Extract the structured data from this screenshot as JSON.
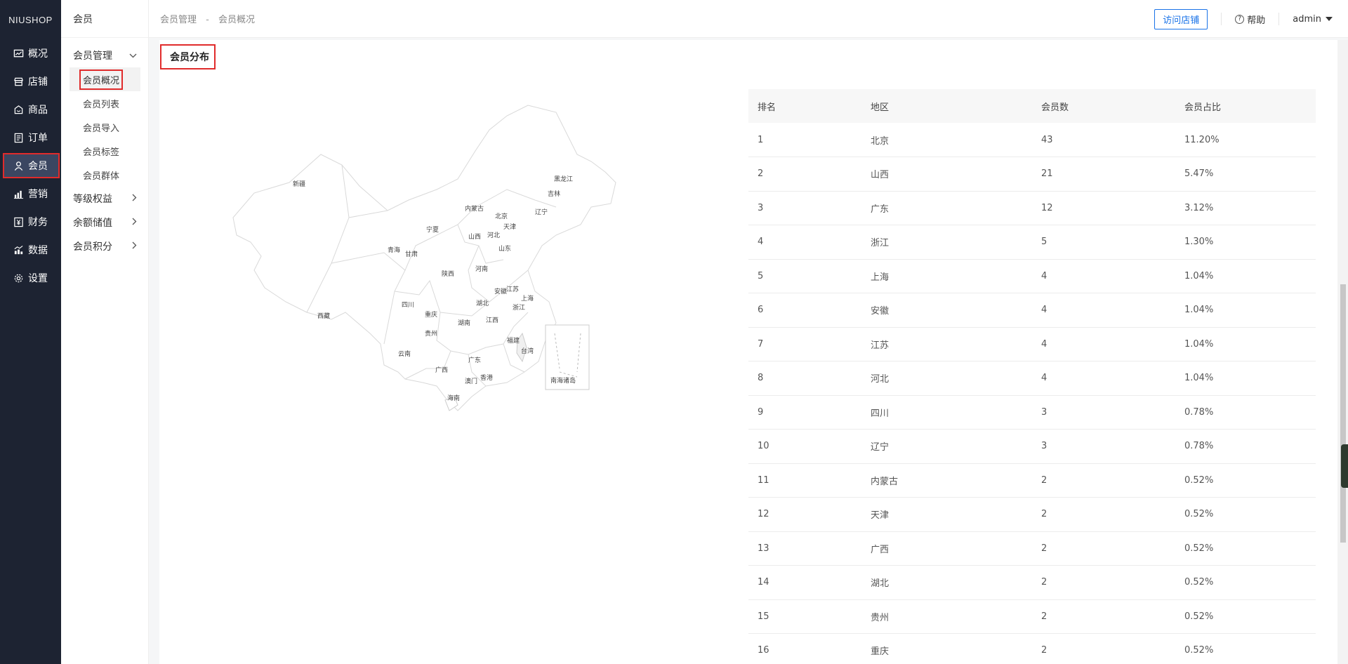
{
  "brand": {
    "logo": "NIUSHOP"
  },
  "nav": [
    {
      "label": "概况",
      "icon": "dashboard-icon"
    },
    {
      "label": "店铺",
      "icon": "store-icon"
    },
    {
      "label": "商品",
      "icon": "goods-icon"
    },
    {
      "label": "订单",
      "icon": "order-icon"
    },
    {
      "label": "会员",
      "icon": "user-icon",
      "active": true
    },
    {
      "label": "营销",
      "icon": "chart-bar-icon"
    },
    {
      "label": "财务",
      "icon": "finance-icon"
    },
    {
      "label": "数据",
      "icon": "data-icon"
    },
    {
      "label": "设置",
      "icon": "gear-icon"
    }
  ],
  "subnav": {
    "title": "会员",
    "group1": "会员管理",
    "items": [
      "会员概况",
      "会员列表",
      "会员导入",
      "会员标签",
      "会员群体"
    ],
    "groups": [
      "等级权益",
      "余额储值",
      "会员积分"
    ]
  },
  "header": {
    "crumb1": "会员管理",
    "sep": "-",
    "crumb2": "会员概况",
    "visit": "访问店铺",
    "help": "帮助",
    "user": "admin"
  },
  "section": {
    "title": "会员分布"
  },
  "map": {
    "labels": [
      "新疆",
      "西藏",
      "青海",
      "甘肃",
      "宁夏",
      "内蒙古",
      "北京",
      "天津",
      "河北",
      "山西",
      "山东",
      "陕西",
      "河南",
      "四川",
      "重庆",
      "湖北",
      "安徽",
      "江苏",
      "上海",
      "浙江",
      "湖南",
      "江西",
      "贵州",
      "云南",
      "广西",
      "广东",
      "福建",
      "台湾",
      "香港",
      "澳门",
      "海南",
      "黑龙江",
      "吉林",
      "辽宁",
      "南海诸岛"
    ]
  },
  "table": {
    "headers": [
      "排名",
      "地区",
      "会员数",
      "会员占比"
    ],
    "rows": [
      [
        "1",
        "北京",
        "43",
        "11.20%"
      ],
      [
        "2",
        "山西",
        "21",
        "5.47%"
      ],
      [
        "3",
        "广东",
        "12",
        "3.12%"
      ],
      [
        "4",
        "浙江",
        "5",
        "1.30%"
      ],
      [
        "5",
        "上海",
        "4",
        "1.04%"
      ],
      [
        "6",
        "安徽",
        "4",
        "1.04%"
      ],
      [
        "7",
        "江苏",
        "4",
        "1.04%"
      ],
      [
        "8",
        "河北",
        "4",
        "1.04%"
      ],
      [
        "9",
        "四川",
        "3",
        "0.78%"
      ],
      [
        "10",
        "辽宁",
        "3",
        "0.78%"
      ],
      [
        "11",
        "内蒙古",
        "2",
        "0.52%"
      ],
      [
        "12",
        "天津",
        "2",
        "0.52%"
      ],
      [
        "13",
        "广西",
        "2",
        "0.52%"
      ],
      [
        "14",
        "湖北",
        "2",
        "0.52%"
      ],
      [
        "15",
        "贵州",
        "2",
        "0.52%"
      ],
      [
        "16",
        "重庆",
        "2",
        "0.52%"
      ]
    ]
  }
}
